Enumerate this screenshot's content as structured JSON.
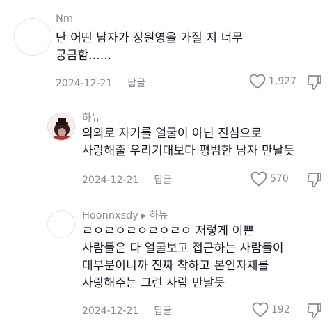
{
  "comments": [
    {
      "author": "Nm",
      "text": "난 어떤 남자가 장원영을 가질 지 너무\n궁금함......",
      "date": "2024-12-21",
      "reply_label": "답글",
      "likes": "1,927"
    },
    {
      "author": "하뉴",
      "text": "의외로 자기를 얼굴이 아닌 진심으로\n사랑해줄 우리기대보다 평범한 남자 만날듯",
      "date": "2024-12-21",
      "reply_label": "답글",
      "likes": "570"
    },
    {
      "author": "Hoonnxsdy",
      "reply_to": "하뉴",
      "text": "ㄹㅇㄹㅇㄹㅇㄹㅇㄹㅇ 저렇게 이쁜\n사람들은 다 얼굴보고 접근하는 사람들이\n대부분이니까 진짜 착하고 본인자체를\n사랑해주는 그런 사람 만날듯",
      "date": "2024-12-21",
      "reply_label": "답글",
      "likes": "192"
    }
  ],
  "colors": {
    "text": "#161823",
    "muted": "#8a8b91"
  },
  "icons": {
    "like": "heart-outline-icon",
    "dislike": "thumbs-down-icon",
    "reply_arrow": "caret-right-icon"
  }
}
